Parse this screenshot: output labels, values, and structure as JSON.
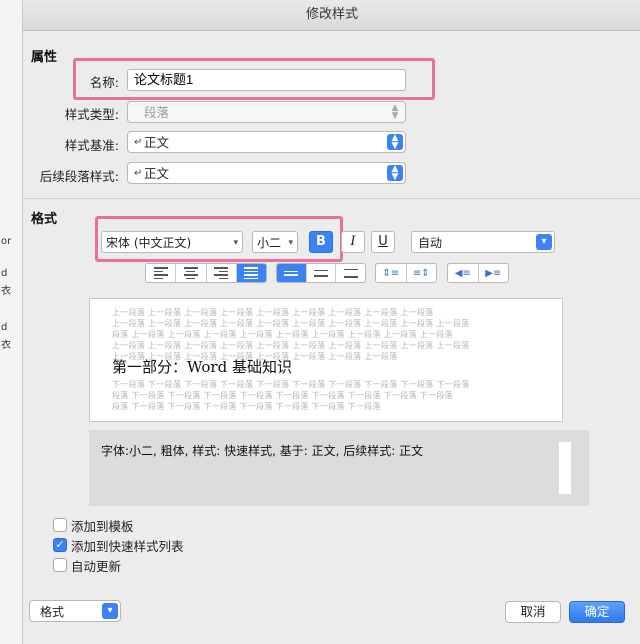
{
  "background_doc": {
    "fragments": [
      "or",
      "d",
      "衣",
      "d",
      "衣"
    ]
  },
  "dialog": {
    "title": "修改样式",
    "properties": {
      "section_label": "属性",
      "name_label": "名称:",
      "name_value": "论文标题1",
      "style_type_label": "样式类型:",
      "style_type_value": "段落",
      "based_on_label": "样式基准:",
      "based_on_value": "正文",
      "next_style_label": "后续段落样式:",
      "next_style_value": "正文"
    },
    "format": {
      "section_label": "格式",
      "font_value": "宋体 (中文正文)",
      "size_value": "小二",
      "bold_label": "B",
      "italic_label": "I",
      "underline_label": "U",
      "color_value": "自动"
    },
    "preview": {
      "prev_paragraph": [
        "上一段落 上一段落 上一段落 上一段落 上一段落 上一段落 上一段落 上一段落 上一段落",
        "上一段落 上一段落 上一段落 上一段落 上一段落 上一段落 上一段落 上一段落 上一段落 上一段落",
        "段落 上一段落 上一段落 上一段落 上一段落 上一段落 上一段落 上一段落 上一段落 上一段落",
        "上一段落 上一段落 上一段落 上一段落 上一段落 上一段落 上一段落 上一段落 上一段落 上一段落",
        "上一段落 上一段落 上一段落 上一段落 上一段落 上一段落 上一段落 上一段落"
      ],
      "heading": "第一部分：Word 基础知识",
      "next_paragraph": [
        "下一段落 下一段落 下一段落 下一段落 下一段落 下一段落 下一段落 下一段落 下一段落 下一段落",
        "段落 下一段落 下一段落 下一段落 下一段落 下一段落 下一段落 下一段落 下一段落 下一段落",
        "段落 下一段落 下一段落 下一段落 下一段落 下一段落 下一段落 下一段落"
      ]
    },
    "description": "字体:小二, 粗体, 样式: 快速样式, 基于: 正文, 后续样式: 正文",
    "options": {
      "add_to_template": "添加到模板",
      "add_to_quick_styles": "添加到快速样式列表",
      "auto_update": "自动更新",
      "add_to_template_checked": false,
      "add_to_quick_styles_checked": true,
      "auto_update_checked": false
    },
    "footer": {
      "format_menu": "格式",
      "cancel": "取消",
      "ok": "确定"
    }
  },
  "colors": {
    "accent": "#3b82f6",
    "highlight": "#e86fa0"
  }
}
